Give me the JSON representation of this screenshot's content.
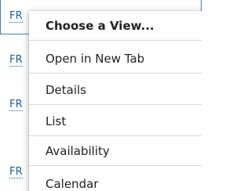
{
  "background_rows": [
    "FR",
    "FR",
    "FR",
    "FR"
  ],
  "menu": {
    "heading": "Choose a View...",
    "items": [
      "Open in New Tab",
      "Details",
      "List",
      "Availability",
      "Calendar"
    ]
  },
  "colors": {
    "link": "#1f5d99",
    "frame": "#4a7bb4",
    "text": "#222222",
    "divider": "#d6d6d6"
  }
}
